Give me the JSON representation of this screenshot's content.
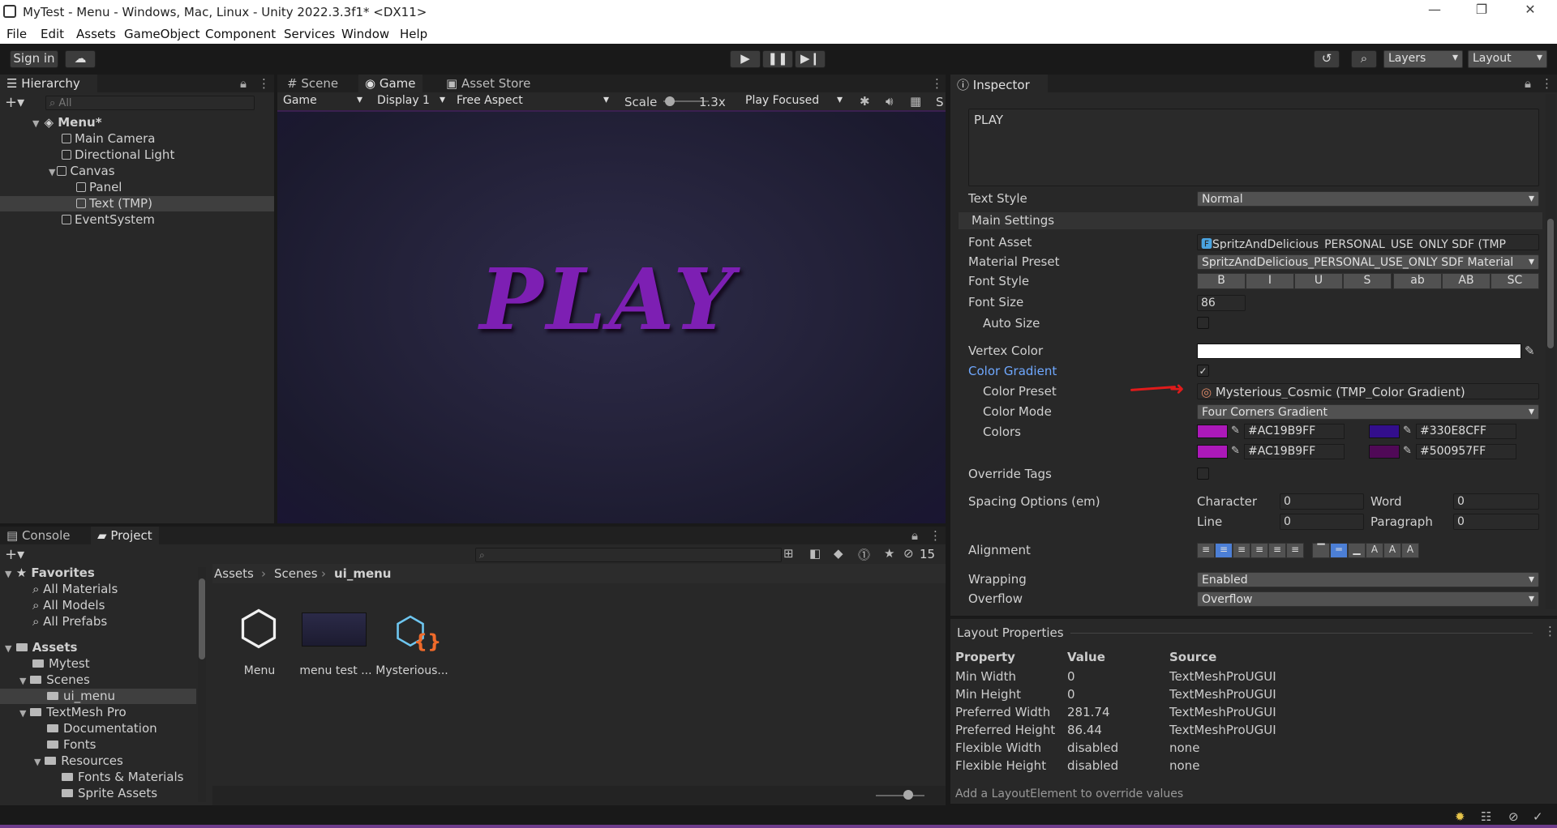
{
  "window": {
    "title": "MyTest - Menu - Windows, Mac, Linux - Unity 2022.3.3f1* <DX11>",
    "minimize": "—",
    "maximize": "❐",
    "close": "✕"
  },
  "menu": [
    "File",
    "Edit",
    "Assets",
    "GameObject",
    "Component",
    "Services",
    "Window",
    "Help"
  ],
  "toolbar": {
    "sign_in": "Sign in",
    "layers": "Layers",
    "layout": "Layout"
  },
  "hierarchy": {
    "tab": "Hierarchy",
    "search_placeholder": "All",
    "scene": "Menu*",
    "items": [
      "Main Camera",
      "Directional Light",
      "Canvas",
      "Panel",
      "Text (TMP)",
      "EventSystem"
    ]
  },
  "gameview": {
    "tabs": [
      "Scene",
      "Game",
      "Asset Store"
    ],
    "mode": "Game",
    "display": "Display 1",
    "aspect": "Free Aspect",
    "scale_label": "Scale",
    "scale_value": "1.3x",
    "play_focused": "Play Focused",
    "overflow_label": "S",
    "play_text": "PLAY"
  },
  "inspector": {
    "tab": "Inspector",
    "text_value": "PLAY",
    "text_style_label": "Text Style",
    "text_style": "Normal",
    "main_settings": "Main Settings",
    "font_asset_label": "Font Asset",
    "font_asset": "SpritzAndDelicious_PERSONAL_USE_ONLY SDF (TMP",
    "material_preset_label": "Material Preset",
    "material_preset": "SpritzAndDelicious_PERSONAL_USE_ONLY SDF Material",
    "font_style_label": "Font Style",
    "font_styles": [
      "B",
      "I",
      "U",
      "S",
      "ab",
      "AB",
      "SC"
    ],
    "font_size_label": "Font Size",
    "font_size": "86",
    "auto_size_label": "Auto Size",
    "vertex_color_label": "Vertex Color",
    "color_gradient_label": "Color Gradient",
    "color_preset_label": "Color Preset",
    "color_preset": "Mysterious_Cosmic (TMP_Color Gradient)",
    "color_mode_label": "Color Mode",
    "color_mode": "Four Corners Gradient",
    "colors_label": "Colors",
    "colors": [
      {
        "hex": "#AC19B9FF",
        "swatch": "#AC19B9"
      },
      {
        "hex": "#330E8CFF",
        "swatch": "#330E8C"
      },
      {
        "hex": "#AC19B9FF",
        "swatch": "#AC19B9"
      },
      {
        "hex": "#500957FF",
        "swatch": "#500957"
      }
    ],
    "override_tags_label": "Override Tags",
    "spacing_label": "Spacing Options (em)",
    "character_label": "Character",
    "character": "0",
    "word_label": "Word",
    "word": "0",
    "line_label": "Line",
    "line": "0",
    "paragraph_label": "Paragraph",
    "paragraph": "0",
    "alignment_label": "Alignment",
    "wrapping_label": "Wrapping",
    "wrapping": "Enabled",
    "overflow_label": "Overflow",
    "overflow": "Overflow"
  },
  "layout_props": {
    "title": "Layout Properties",
    "headers": [
      "Property",
      "Value",
      "Source"
    ],
    "rows": [
      [
        "Min Width",
        "0",
        "TextMeshProUGUI"
      ],
      [
        "Min Height",
        "0",
        "TextMeshProUGUI"
      ],
      [
        "Preferred Width",
        "281.74",
        "TextMeshProUGUI"
      ],
      [
        "Preferred Height",
        "86.44",
        "TextMeshProUGUI"
      ],
      [
        "Flexible Width",
        "disabled",
        "none"
      ],
      [
        "Flexible Height",
        "disabled",
        "none"
      ]
    ],
    "footer": "Add a LayoutElement to override values"
  },
  "project": {
    "tabs": [
      "Console",
      "Project"
    ],
    "badge": "15",
    "breadcrumb": [
      "Assets",
      "Scenes",
      "ui_menu"
    ],
    "favorites": "Favorites",
    "fav_items": [
      "All Materials",
      "All Models",
      "All Prefabs"
    ],
    "assets": "Assets",
    "tree": [
      "Mytest",
      "Scenes",
      "ui_menu",
      "TextMesh Pro",
      "Documentation",
      "Fonts",
      "Resources",
      "Fonts & Materials",
      "Sprite Assets"
    ],
    "files": [
      "Menu",
      "menu test ...",
      "Mysterious..."
    ]
  },
  "colors": {
    "accent": "#4c7fd6",
    "play_text": "#7d1fb3",
    "gradient_link": "#6fa8ff",
    "arrow": "#e01b1b"
  }
}
